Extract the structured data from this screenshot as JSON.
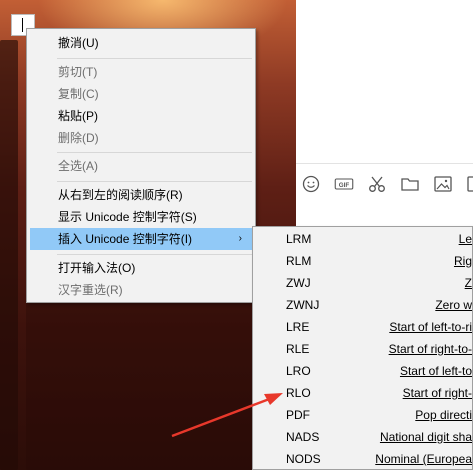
{
  "context_menu": {
    "items": [
      {
        "label": "撤消(U)",
        "enabled": true
      },
      {
        "label": "剪切(T)",
        "enabled": false
      },
      {
        "label": "复制(C)",
        "enabled": false
      },
      {
        "label": "粘贴(P)",
        "enabled": true
      },
      {
        "label": "删除(D)",
        "enabled": false
      },
      {
        "label": "全选(A)",
        "enabled": false
      },
      {
        "label": "从右到左的阅读顺序(R)",
        "enabled": true
      },
      {
        "label": "显示 Unicode 控制字符(S)",
        "enabled": true
      },
      {
        "label": "插入 Unicode 控制字符(I)",
        "enabled": true,
        "highlighted": true,
        "has_submenu": true
      },
      {
        "label": "打开输入法(O)",
        "enabled": true
      },
      {
        "label": "汉字重选(R)",
        "enabled": false
      }
    ],
    "submenu_arrow": "›"
  },
  "submenu": {
    "items": [
      {
        "code": "LRM",
        "desc": "Le"
      },
      {
        "code": "RLM",
        "desc": "Rig"
      },
      {
        "code": "ZWJ",
        "desc": "Z"
      },
      {
        "code": "ZWNJ",
        "desc": "Zero w"
      },
      {
        "code": "LRE",
        "desc": "Start of left-to-ri"
      },
      {
        "code": "RLE",
        "desc": "Start of right-to-"
      },
      {
        "code": "LRO",
        "desc": "Start of left-to"
      },
      {
        "code": "RLO",
        "desc": "Start of right-"
      },
      {
        "code": "PDF",
        "desc": "Pop directi"
      },
      {
        "code": "NADS",
        "desc": "National digit sha"
      },
      {
        "code": "NODS",
        "desc": "Nominal (Europea"
      }
    ]
  },
  "toolbar": {
    "icons": [
      "emoji-icon",
      "gif-icon",
      "scissors-icon",
      "folder-icon",
      "image-icon",
      "screenshot-icon"
    ],
    "gif_text": "GIF"
  },
  "annotation": {
    "color": "#e8382b",
    "points_to": "RLO"
  }
}
